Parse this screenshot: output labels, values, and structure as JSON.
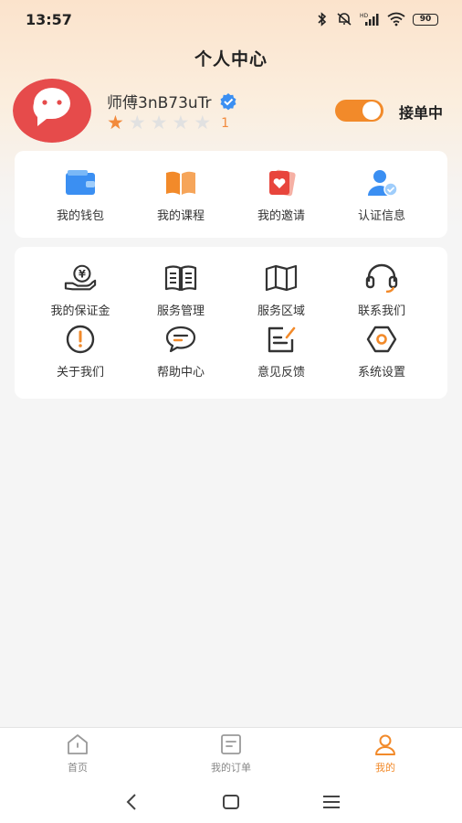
{
  "status": {
    "time": "13:57",
    "battery": "90"
  },
  "page": {
    "title": "个人中心"
  },
  "profile": {
    "name": "师傅3nB73uTr",
    "rating_filled": 1,
    "rating_total": 5,
    "rating_count": "1",
    "accept_orders_on": true,
    "accept_orders_label": "接单中"
  },
  "quick_actions": [
    {
      "label": "我的钱包",
      "icon": "wallet-icon"
    },
    {
      "label": "我的课程",
      "icon": "book-icon"
    },
    {
      "label": "我的邀请",
      "icon": "invite-icon"
    },
    {
      "label": "认证信息",
      "icon": "verify-user-icon"
    }
  ],
  "services": [
    {
      "label": "我的保证金",
      "icon": "deposit-icon"
    },
    {
      "label": "服务管理",
      "icon": "manual-icon"
    },
    {
      "label": "服务区域",
      "icon": "map-icon"
    },
    {
      "label": "联系我们",
      "icon": "headset-icon"
    },
    {
      "label": "关于我们",
      "icon": "info-icon"
    },
    {
      "label": "帮助中心",
      "icon": "chat-icon"
    },
    {
      "label": "意见反馈",
      "icon": "feedback-icon"
    },
    {
      "label": "系统设置",
      "icon": "settings-icon"
    }
  ],
  "tabs": [
    {
      "label": "首页",
      "icon": "home-icon"
    },
    {
      "label": "我的订单",
      "icon": "orders-icon"
    },
    {
      "label": "我的",
      "icon": "profile-icon",
      "active": true
    }
  ],
  "colors": {
    "accent": "#f28a2a",
    "star": "#f28a3c",
    "avatar": "#e64b4b",
    "blue": "#3b8ff2"
  }
}
